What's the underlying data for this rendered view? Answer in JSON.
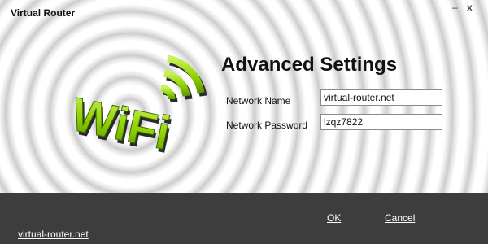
{
  "window": {
    "title": "Virtual Router",
    "minimize_label": "–",
    "close_label": "x"
  },
  "settings": {
    "heading": "Advanced Settings",
    "network_name_label": "Network Name",
    "network_name_value": "virtual-router.net",
    "network_password_label": "Network Password",
    "network_password_value": "lzqz7822"
  },
  "footer": {
    "ok_label": "OK",
    "cancel_label": "Cancel",
    "site_link": "virtual-router.net"
  },
  "logo": {
    "text": "WiFi",
    "icon": "wifi-logo-icon"
  },
  "colors": {
    "accent_green": "#8dd100",
    "footer_bg": "#3d3d3d"
  }
}
